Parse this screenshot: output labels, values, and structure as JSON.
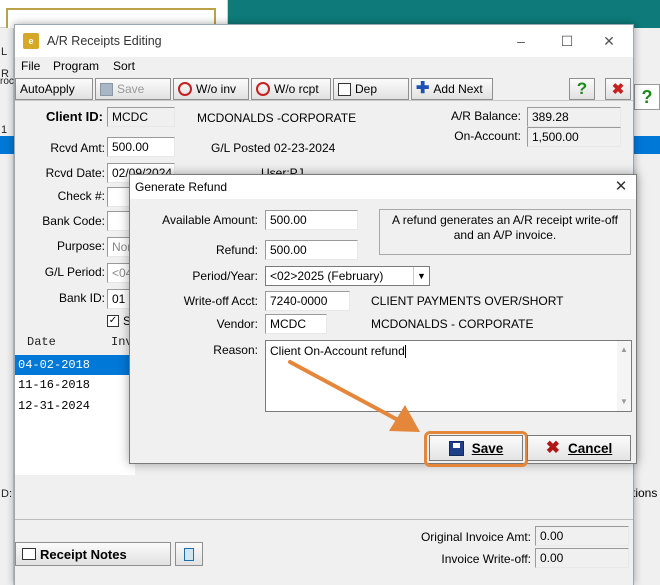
{
  "background": {
    "left_fragments": [
      "L",
      "R",
      "roc",
      "1",
      "D:"
    ],
    "right_fragment": "tions"
  },
  "window": {
    "title": "A/R Receipts Editing",
    "controls": [
      "–",
      "☐",
      "✕"
    ]
  },
  "menu": [
    "File",
    "Program",
    "Sort"
  ],
  "toolbar": {
    "autoapply": "AutoApply",
    "save": "Save",
    "wo_inv": "W/o inv",
    "wo_rcpt": "W/o rcpt",
    "dep": "Dep",
    "add_next": "Add Next",
    "help": "?",
    "close": "✖"
  },
  "form": {
    "client_id_label": "Client ID:",
    "client_id": "MCDC",
    "client_name": "MCDONALDS -CORPORATE",
    "rcvd_amt_label": "Rcvd Amt:",
    "rcvd_amt": "500.00",
    "gl_posted": "G/L Posted 02-23-2024",
    "rcvd_date_label": "Rcvd Date:",
    "rcvd_date": "02/09/2024",
    "user": "User:PJ",
    "check_label": "Check #:",
    "bank_code_label": "Bank Code:",
    "purpose_label": "Purpose:",
    "purpose": "Nor",
    "gl_period_label": "G/L Period:",
    "gl_period": "<04",
    "bank_id_label": "Bank ID:",
    "bank_id": "01",
    "checkbox_fragment": "S",
    "ar_balance_label": "A/R Balance:",
    "ar_balance": "389.28",
    "on_account_label": "On-Account:",
    "on_account": "1,500.00"
  },
  "list": {
    "header_date": "Date",
    "header_inv": "Inv",
    "rows": [
      "04-02-2018",
      "11-16-2018",
      "12-31-2024"
    ]
  },
  "bottom": {
    "receipt_notes": "Receipt Notes",
    "orig_invoice_label": "Original Invoice Amt:",
    "orig_invoice": "0.00",
    "invoice_writeoff_label": "Invoice Write-off:",
    "invoice_writeoff": "0.00"
  },
  "dialog": {
    "title": "Generate Refund",
    "available_amount_label": "Available Amount:",
    "available_amount": "500.00",
    "refund_label": "Refund:",
    "refund": "500.00",
    "info": "A refund generates an A/R receipt write-off and an A/P invoice.",
    "period_year_label": "Period/Year:",
    "period_year": "<02>2025 (February)",
    "writeoff_acct_label": "Write-off Acct:",
    "writeoff_acct": "7240-0000",
    "writeoff_acct_name": "CLIENT PAYMENTS OVER/SHORT",
    "vendor_label": "Vendor:",
    "vendor": "MCDC",
    "vendor_name": "MCDONALDS - CORPORATE",
    "reason_label": "Reason:",
    "reason": "Client On-Account refund",
    "save": "Save",
    "cancel": "Cancel"
  },
  "colors": {
    "desktop": "#0e7a7a",
    "selection": "#0078d7",
    "annotation": "#e4873a"
  }
}
